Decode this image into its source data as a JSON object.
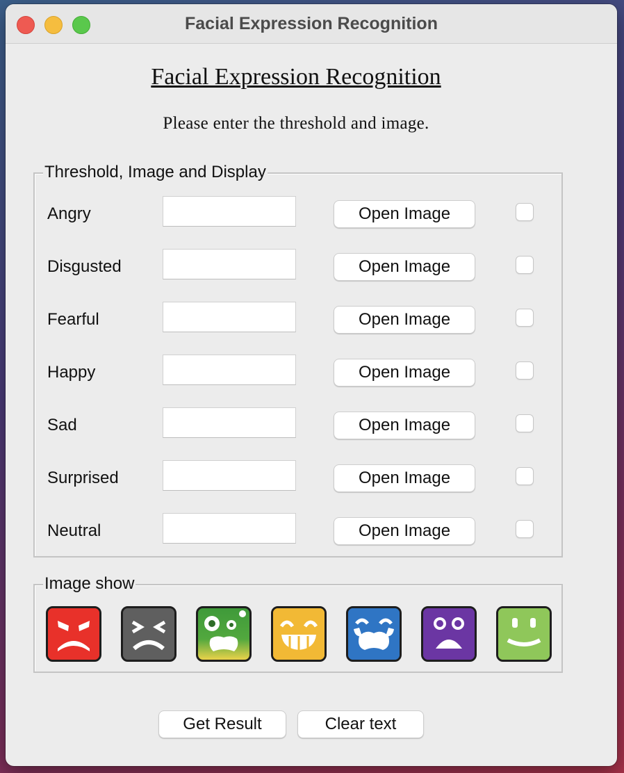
{
  "window": {
    "title": "Facial Expression Recognition"
  },
  "main": {
    "heading": "Facial Expression Recognition",
    "instruction": "Please enter the threshold and image."
  },
  "threshold_group": {
    "legend": "Threshold, Image and Display",
    "rows": [
      {
        "label": "Angry",
        "value": "",
        "button_label": "Open Image",
        "checked": false
      },
      {
        "label": "Disgusted",
        "value": "",
        "button_label": "Open Image",
        "checked": false
      },
      {
        "label": "Fearful",
        "value": "",
        "button_label": "Open Image",
        "checked": false
      },
      {
        "label": "Happy",
        "value": "",
        "button_label": "Open Image",
        "checked": false
      },
      {
        "label": "Sad",
        "value": "",
        "button_label": "Open Image",
        "checked": false
      },
      {
        "label": "Surprised",
        "value": "",
        "button_label": "Open Image",
        "checked": false
      },
      {
        "label": "Neutral",
        "value": "",
        "button_label": "Open Image",
        "checked": false
      }
    ]
  },
  "image_group": {
    "legend": "Image show",
    "emojis": [
      {
        "icon": "angry-face-icon",
        "color": "#e8312a"
      },
      {
        "icon": "disgusted-face-icon",
        "color": "#5f5f5f"
      },
      {
        "icon": "fearful-face-icon",
        "color": "#48a23c"
      },
      {
        "icon": "happy-face-icon",
        "color": "#f2b935"
      },
      {
        "icon": "sad-face-icon",
        "color": "#2f75c4"
      },
      {
        "icon": "surprised-face-icon",
        "color": "#6b36a3"
      },
      {
        "icon": "neutral-face-icon",
        "color": "#8fc75a"
      }
    ]
  },
  "actions": {
    "get_result_label": "Get Result",
    "clear_text_label": "Clear text"
  }
}
